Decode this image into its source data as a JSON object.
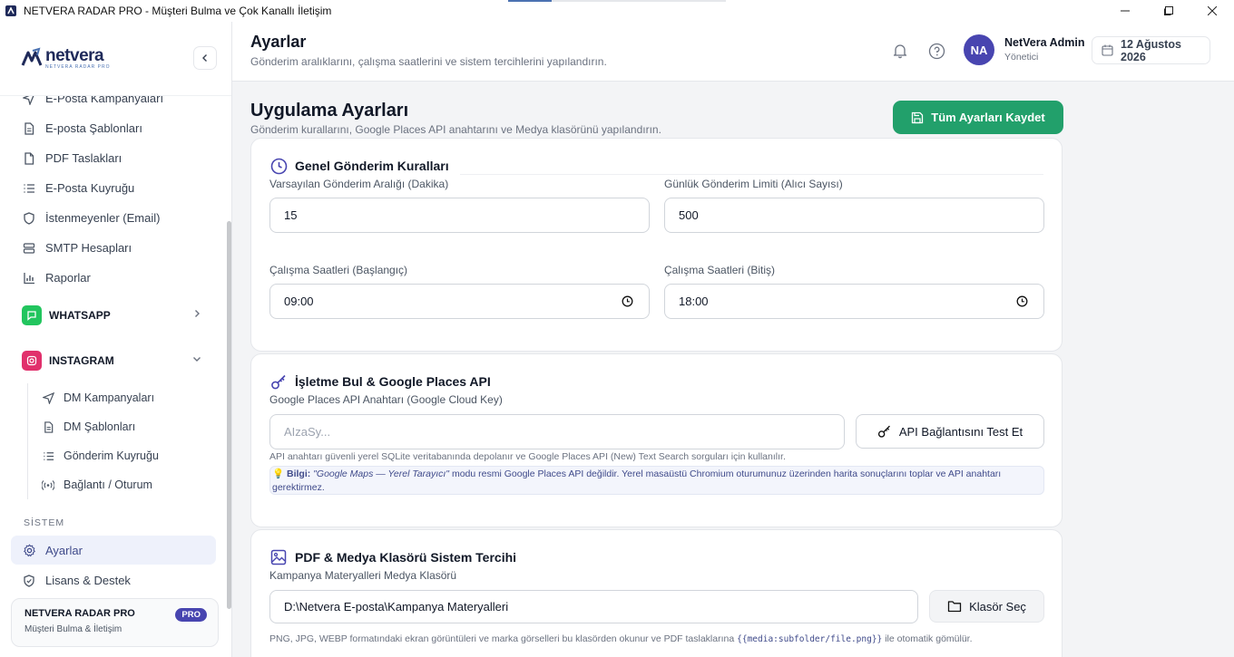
{
  "window": {
    "title": "NETVERA RADAR PRO - Müşteri Bulma ve Çok Kanallı İletişim"
  },
  "brand": {
    "name": "netvera",
    "tagline": "NETVERA RADAR PRO"
  },
  "sidebar": {
    "email_items": [
      {
        "label": "E-Posta Kampanyaları",
        "icon": "send-icon"
      },
      {
        "label": "E-posta Şablonları",
        "icon": "document-icon"
      },
      {
        "label": "PDF Taslakları",
        "icon": "pdf-icon"
      },
      {
        "label": "E-Posta Kuyruğu",
        "icon": "list-icon"
      },
      {
        "label": "İstenmeyenler (Email)",
        "icon": "shield-icon"
      },
      {
        "label": "SMTP Hesapları",
        "icon": "server-icon"
      },
      {
        "label": "Raporlar",
        "icon": "chart-icon"
      }
    ],
    "whatsapp": {
      "label": "WHATSAPP",
      "color": "#22c55e"
    },
    "instagram": {
      "label": "INSTAGRAM",
      "color": "#e1306c",
      "items": [
        {
          "label": "DM Kampanyaları",
          "icon": "send-icon"
        },
        {
          "label": "DM Şablonları",
          "icon": "document-icon"
        },
        {
          "label": "Gönderim Kuyruğu",
          "icon": "list-icon"
        },
        {
          "label": "Bağlantı / Oturum",
          "icon": "signal-icon"
        }
      ]
    },
    "system_section": "SİSTEM",
    "system_items": [
      {
        "label": "Ayarlar",
        "icon": "gear-icon",
        "active": true
      },
      {
        "label": "Lisans & Destek",
        "icon": "shield-icon"
      }
    ],
    "promo": {
      "title": "NETVERA RADAR PRO",
      "subtitle": "Müşteri Bulma & İletişim",
      "badge": "PRO"
    }
  },
  "header": {
    "title": "Ayarlar",
    "subtitle": "Gönderim aralıklarını, çalışma saatlerini ve sistem tercihlerini yapılandırın.",
    "user": {
      "initials": "NA",
      "name": "NetVera Admin",
      "role": "Yönetici"
    },
    "date": "12 Ağustos 2026"
  },
  "main": {
    "title": "Uygulama Ayarları",
    "subtitle": "Gönderim kurallarını, Google Places API anahtarını ve Medya klasörünü yapılandırın.",
    "save_label": "Tüm Ayarları Kaydet",
    "general": {
      "heading": "Genel Gönderim Kuralları",
      "interval_label": "Varsayılan Gönderim Aralığı (Dakika)",
      "interval_value": "15",
      "limit_label": "Günlük Gönderim Limiti (Alıcı Sayısı)",
      "limit_value": "500",
      "start_label": "Çalışma Saatleri (Başlangıç)",
      "start_value": "09:00",
      "end_label": "Çalışma Saatleri (Bitiş)",
      "end_value": "18:00"
    },
    "places": {
      "heading": "İşletme Bul & Google Places API",
      "key_label": "Google Places API Anahtarı (Google Cloud Key)",
      "key_placeholder": "AIzaSy...",
      "test_label": "API Bağlantısını Test Et",
      "hint": "API anahtarı güvenli yerel SQLite veritabanında depolanır ve Google Places API (New) Text Search sorguları için kullanılır.",
      "info_bold": "Bilgi:",
      "info_italic": "\"Google Maps — Yerel Tarayıcı\"",
      "info_text": " modu resmi Google Places API değildir. Yerel masaüstü Chromium oturumunuz üzerinden harita sonuçlarını toplar ve API anahtarı gerektirmez."
    },
    "media": {
      "heading": "PDF & Medya Klasörü Sistem Tercihi",
      "folder_label": "Kampanya Materyalleri Medya Klasörü",
      "folder_value": "D:\\Netvera E-posta\\Kampanya Materyalleri",
      "choose_label": "Klasör Seç",
      "hint_before": "PNG, JPG, WEBP formatındaki ekran görüntüleri ve marka görselleri bu klasörden okunur ve PDF taslaklarına",
      "hint_code": "{{media:subfolder/file.png}}",
      "hint_after": "ile otomatik gömülür."
    }
  },
  "colors": {
    "accent": "#4845b0",
    "success": "#22a06b"
  }
}
